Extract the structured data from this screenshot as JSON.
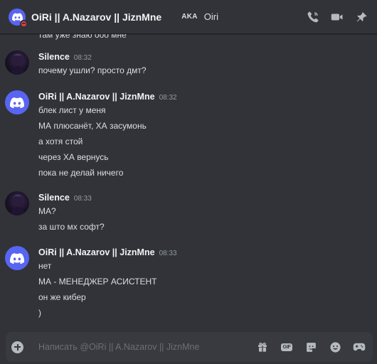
{
  "header": {
    "title": "OiRi || A.Nazarov || JiznMne",
    "aka_label": "AKA",
    "aka_name": "Oiri"
  },
  "top_fragment": "там уже знаю ооо мне",
  "messages": [
    {
      "author": "Silence",
      "time": "08:32",
      "lines": [
        "почему ушли? просто дмт?"
      ]
    },
    {
      "author": "OiRi || A.Nazarov || JiznMne",
      "time": "08:32",
      "lines": [
        "блек лист у меня",
        "МА плюсанёт, ХА засумонь",
        "а хотя стой",
        "через ХА вернусь",
        "пока не делай ничего"
      ]
    },
    {
      "author": "Silence",
      "time": "08:33",
      "lines": [
        "МА?",
        "за што мх софт?"
      ]
    },
    {
      "author": "OiRi || A.Nazarov || JiznMne",
      "time": "08:33",
      "lines": [
        "нет",
        "МА - МЕНЕДЖЕР АСИСТЕНТ",
        "он же кибер",
        ")"
      ]
    }
  ],
  "composer": {
    "placeholder": "Написать @OiRi || A.Nazarov || JiznMne",
    "gif_label": "GIF"
  },
  "colors": {
    "accent": "#5865f2",
    "background": "#313338",
    "dnd_status": "#f23f43"
  }
}
